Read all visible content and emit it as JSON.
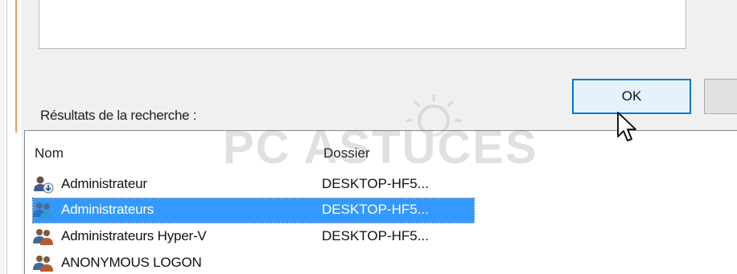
{
  "dialog": {
    "results_label": "Résultats de la recherche :",
    "ok_label": "OK",
    "cancel_label": ""
  },
  "results": {
    "columns": {
      "name": "Nom",
      "folder": "Dossier"
    },
    "rows": [
      {
        "name": "Administrateur",
        "folder": "DESKTOP-HF5...",
        "icon": "user-icon",
        "selected": false
      },
      {
        "name": "Administrateurs",
        "folder": "DESKTOP-HF5...",
        "icon": "group-icon",
        "selected": true
      },
      {
        "name": "Administrateurs Hyper-V",
        "folder": "DESKTOP-HF5...",
        "icon": "group-icon",
        "selected": false
      },
      {
        "name": "ANONYMOUS LOGON",
        "folder": "",
        "icon": "group-icon",
        "selected": false
      }
    ]
  },
  "watermark": {
    "text": "PC ASTUCES"
  },
  "colors": {
    "selection": "#3399ff",
    "ok_border": "#0078d7",
    "ok_bg": "#e5f1fb",
    "dialog_bg": "#f0f0f0"
  }
}
